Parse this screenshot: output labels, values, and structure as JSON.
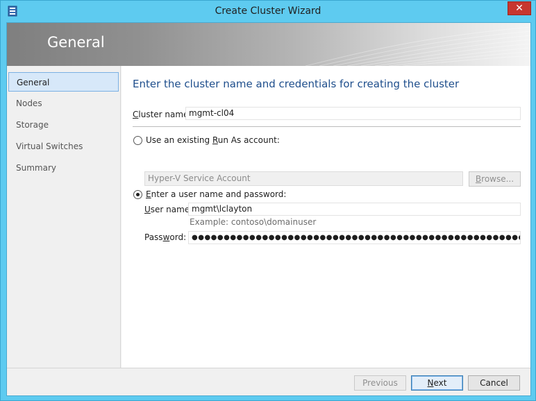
{
  "window": {
    "title": "Create Cluster Wizard",
    "close_glyph": "✕"
  },
  "banner": {
    "title": "General"
  },
  "nav": {
    "items": [
      {
        "label": "General",
        "selected": true
      },
      {
        "label": "Nodes"
      },
      {
        "label": "Storage"
      },
      {
        "label": "Virtual Switches"
      },
      {
        "label": "Summary"
      }
    ]
  },
  "content": {
    "heading": "Enter the cluster name and credentials for creating the cluster",
    "cluster_name": {
      "label_pre": "",
      "label_key": "C",
      "label_post": "luster name:",
      "value": "mgmt-cl04"
    },
    "runas_option": {
      "label_pre": "Use an existing ",
      "label_key": "R",
      "label_post": "un As account:",
      "selected": false
    },
    "runas_account": {
      "value": "Hyper-V Service Account"
    },
    "browse_button": {
      "label_pre": "",
      "label_key": "B",
      "label_post": "rowse..."
    },
    "userpass_option": {
      "label_pre": "",
      "label_key": "E",
      "label_post": "nter a user name and password:",
      "selected": true
    },
    "username": {
      "label_pre": "",
      "label_key": "U",
      "label_post": "ser name:",
      "value": "mgmt\\lclayton",
      "example": "Example: contoso\\domainuser"
    },
    "password": {
      "label_pre": "Pass",
      "label_key": "w",
      "label_post": "ord:",
      "value": "●●●●●●●●●●●●●●●●●●●●●●●●●●●●●●●●●●●●●●●●●●●●●●●●●●●●●●●●●●●●●●●●"
    }
  },
  "footer": {
    "previous": {
      "label": "Previous",
      "enabled": false
    },
    "next": {
      "label_pre": "",
      "label_key": "N",
      "label_post": "ext"
    },
    "cancel": {
      "label": "Cancel"
    }
  }
}
